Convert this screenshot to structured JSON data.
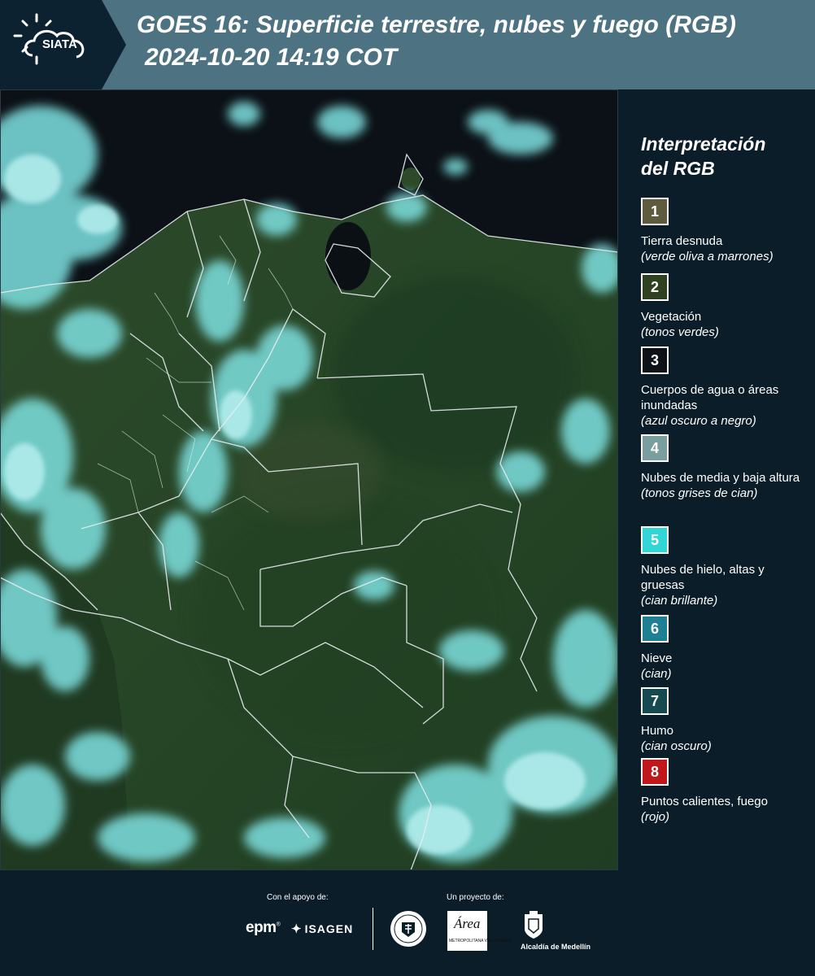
{
  "header": {
    "logo_text": "SIATA",
    "title_line1": "GOES 16: Superficie terrestre, nubes y fuego (RGB)",
    "title_line2": "2024-10-20 14:19 COT"
  },
  "legend": {
    "title_line1": "Interpretación",
    "title_line2": "del RGB",
    "items": [
      {
        "number": "1",
        "color": "#5e5b3e",
        "label": "Tierra desnuda",
        "sub": "(verde oliva a marrones)"
      },
      {
        "number": "2",
        "color": "#2f4121",
        "label": "Vegetación",
        "sub": "(tonos verdes)"
      },
      {
        "number": "3",
        "color": "#0d1218",
        "label": "Cuerpos de agua o áreas inundadas",
        "sub": "(azul oscuro a negro)"
      },
      {
        "number": "4",
        "color": "#7a9ea0",
        "label": "Nubes de media y baja altura",
        "sub": "(tonos grises de cian)"
      },
      {
        "number": "5",
        "color": "#33d6d6",
        "label": "Nubes de hielo, altas y gruesas",
        "sub": "(cian brillante)"
      },
      {
        "number": "6",
        "color": "#1f7f94",
        "label": "Nieve",
        "sub": "(cian)"
      },
      {
        "number": "7",
        "color": "#164a51",
        "label": "Humo",
        "sub": "(cian oscuro)"
      },
      {
        "number": "8",
        "color": "#c0171c",
        "label": "Puntos calientes, fuego",
        "sub": "(rojo)"
      }
    ]
  },
  "footer": {
    "support_label": "Con el apoyo de:",
    "project_label": "Un proyecto de:",
    "sponsor1": "epm",
    "sponsor2": "ISAGEN",
    "project1_word": "Área",
    "project1_sub": "METROPOLITANA Valle de Aburrá",
    "project2": "Alcaldía de Medellín"
  }
}
